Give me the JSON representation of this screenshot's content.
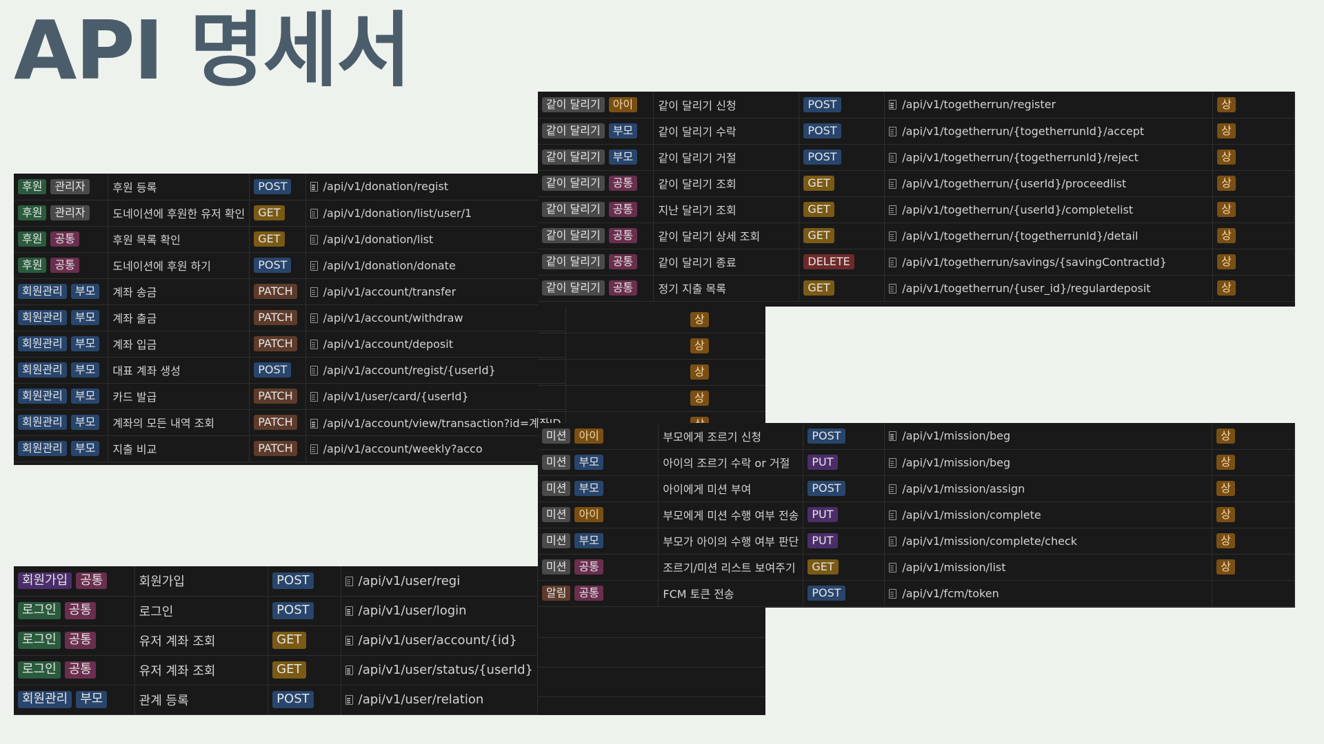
{
  "page": {
    "title": "API 명세서"
  },
  "donation_rows": [
    {
      "category": "후원",
      "role": "관리자",
      "name": "후원 등록",
      "method": "POST",
      "url": "/api/v1/donation/regist"
    },
    {
      "category": "후원",
      "role": "관리자",
      "name": "도네이션에 후원한 유저 확인",
      "method": "GET",
      "url": "/api/v1/donation/list/user/1"
    },
    {
      "category": "후원",
      "role": "공통",
      "name": "후원 목록 확인",
      "method": "GET",
      "url": "/api/v1/donation/list"
    },
    {
      "category": "후원",
      "role": "공통",
      "name": "도네이션에 후원 하기",
      "method": "POST",
      "url": "/api/v1/donation/donate"
    },
    {
      "category": "회원관리",
      "role": "부모",
      "name": "계좌 송금",
      "method": "PATCH",
      "url": "/api/v1/account/transfer"
    },
    {
      "category": "회원관리",
      "role": "부모",
      "name": "계좌 출금",
      "method": "PATCH",
      "url": "/api/v1/account/withdraw",
      "priority": "상"
    },
    {
      "category": "회원관리",
      "role": "부모",
      "name": "계좌 입금",
      "method": "PATCH",
      "url": "/api/v1/account/deposit",
      "priority": "상"
    },
    {
      "category": "회원관리",
      "role": "부모",
      "name": "대표 계좌 생성",
      "method": "POST",
      "url": "/api/v1/account/regist/{userId}",
      "priority": "상"
    },
    {
      "category": "회원관리",
      "role": "부모",
      "name": "카드 발급",
      "method": "PATCH",
      "url": "/api/v1/user/card/{userId}",
      "priority": "상"
    },
    {
      "category": "회원관리",
      "role": "부모",
      "name": "계좌의 모든 내역 조회",
      "method": "PATCH",
      "url": "/api/v1/account/view/transaction?id=계좌ID",
      "priority": "상"
    },
    {
      "category": "회원관리",
      "role": "부모",
      "name": "지출 비교",
      "method": "PATCH",
      "url": "/api/v1/account/weekly?acco"
    }
  ],
  "together_rows": [
    {
      "category": "같이 달리기",
      "role": "아이",
      "name": "같이 달리기 신청",
      "method": "POST",
      "url": "/api/v1/togetherrun/register",
      "priority": "상"
    },
    {
      "category": "같이 달리기",
      "role": "부모",
      "name": "같이 달리기 수락",
      "method": "POST",
      "url": "/api/v1/togetherrun/{togetherrunId}/accept",
      "priority": "상"
    },
    {
      "category": "같이 달리기",
      "role": "부모",
      "name": "같이 달리기 거절",
      "method": "POST",
      "url": "/api/v1/togetherrun/{togetherrunId}/reject",
      "priority": "상"
    },
    {
      "category": "같이 달리기",
      "role": "공통",
      "name": "같이 달리기 조회",
      "method": "GET",
      "url": "/api/v1/togetherrun/{userId}/proceedlist",
      "priority": "상"
    },
    {
      "category": "같이 달리기",
      "role": "공통",
      "name": "지난 달리기 조회",
      "method": "GET",
      "url": "/api/v1/togetherrun/{userId}/completelist",
      "priority": "상"
    },
    {
      "category": "같이 달리기",
      "role": "공통",
      "name": "같이 달리기 상세 조회",
      "method": "GET",
      "url": "/api/v1/togetherrun/{togetherrunId}/detail",
      "priority": "상"
    },
    {
      "category": "같이 달리기",
      "role": "공통",
      "name": "같이 달리기 종료",
      "method": "DELETE",
      "url": "/api/v1/togetherrun/savings/{savingContractId}",
      "priority": "상"
    },
    {
      "category": "같이 달리기",
      "role": "공통",
      "name": "정기 지출 목록",
      "method": "GET",
      "url": "/api/v1/togetherrun/{user_id}/regulardeposit",
      "priority": "상"
    }
  ],
  "mission_rows": [
    {
      "category": "미션",
      "role": "아이",
      "name": "부모에게 조르기 신청",
      "method": "POST",
      "url": "/api/v1/mission/beg",
      "priority": "상"
    },
    {
      "category": "미션",
      "role": "부모",
      "name": "아이의 조르기 수락 or 거절",
      "method": "PUT",
      "url": "/api/v1/mission/beg",
      "priority": "상"
    },
    {
      "category": "미션",
      "role": "부모",
      "name": "아이에게 미션 부여",
      "method": "POST",
      "url": "/api/v1/mission/assign",
      "priority": "상"
    },
    {
      "category": "미션",
      "role": "아이",
      "name": "부모에게 미션 수행 여부 전송",
      "method": "PUT",
      "url": "/api/v1/mission/complete",
      "priority": "상"
    },
    {
      "category": "미션",
      "role": "부모",
      "name": "부모가 아이의 수행 여부 판단",
      "method": "PUT",
      "url": "/api/v1/mission/complete/check",
      "priority": "상"
    },
    {
      "category": "미션",
      "role": "공통",
      "name": "조르기/미션 리스트 보여주기",
      "method": "GET",
      "url": "/api/v1/mission/list",
      "priority": "상"
    },
    {
      "category": "알림",
      "role": "공통",
      "name": "FCM 토큰 전송",
      "method": "POST",
      "url": "/api/v1/fcm/token",
      "priority": ""
    }
  ],
  "signup_rows": [
    {
      "category": "회원가입",
      "role": "공통",
      "name": "회원가입",
      "method": "POST",
      "url": "/api/v1/user/regi"
    },
    {
      "category": "로그인",
      "role": "공통",
      "name": "로그인",
      "method": "POST",
      "url": "/api/v1/user/login"
    },
    {
      "category": "로그인",
      "role": "공통",
      "name": "유저 계좌 조회",
      "method": "GET",
      "url": "/api/v1/user/account/{id}"
    },
    {
      "category": "로그인",
      "role": "공통",
      "name": "유저 계좌 조회",
      "method": "GET",
      "url": "/api/v1/user/status/{userId}"
    },
    {
      "category": "회원관리",
      "role": "부모",
      "name": "관계 등록",
      "method": "POST",
      "url": "/api/v1/user/relation"
    }
  ],
  "colors": {
    "background": "#eef2ec",
    "title": "#4b5d6b",
    "table_bg": "#191919",
    "post": "#28456c",
    "get": "#7a5a14",
    "patch": "#5e3b2b",
    "put": "#4a2e6a",
    "delete": "#6e2a2a",
    "priority": "#7a4f14"
  }
}
